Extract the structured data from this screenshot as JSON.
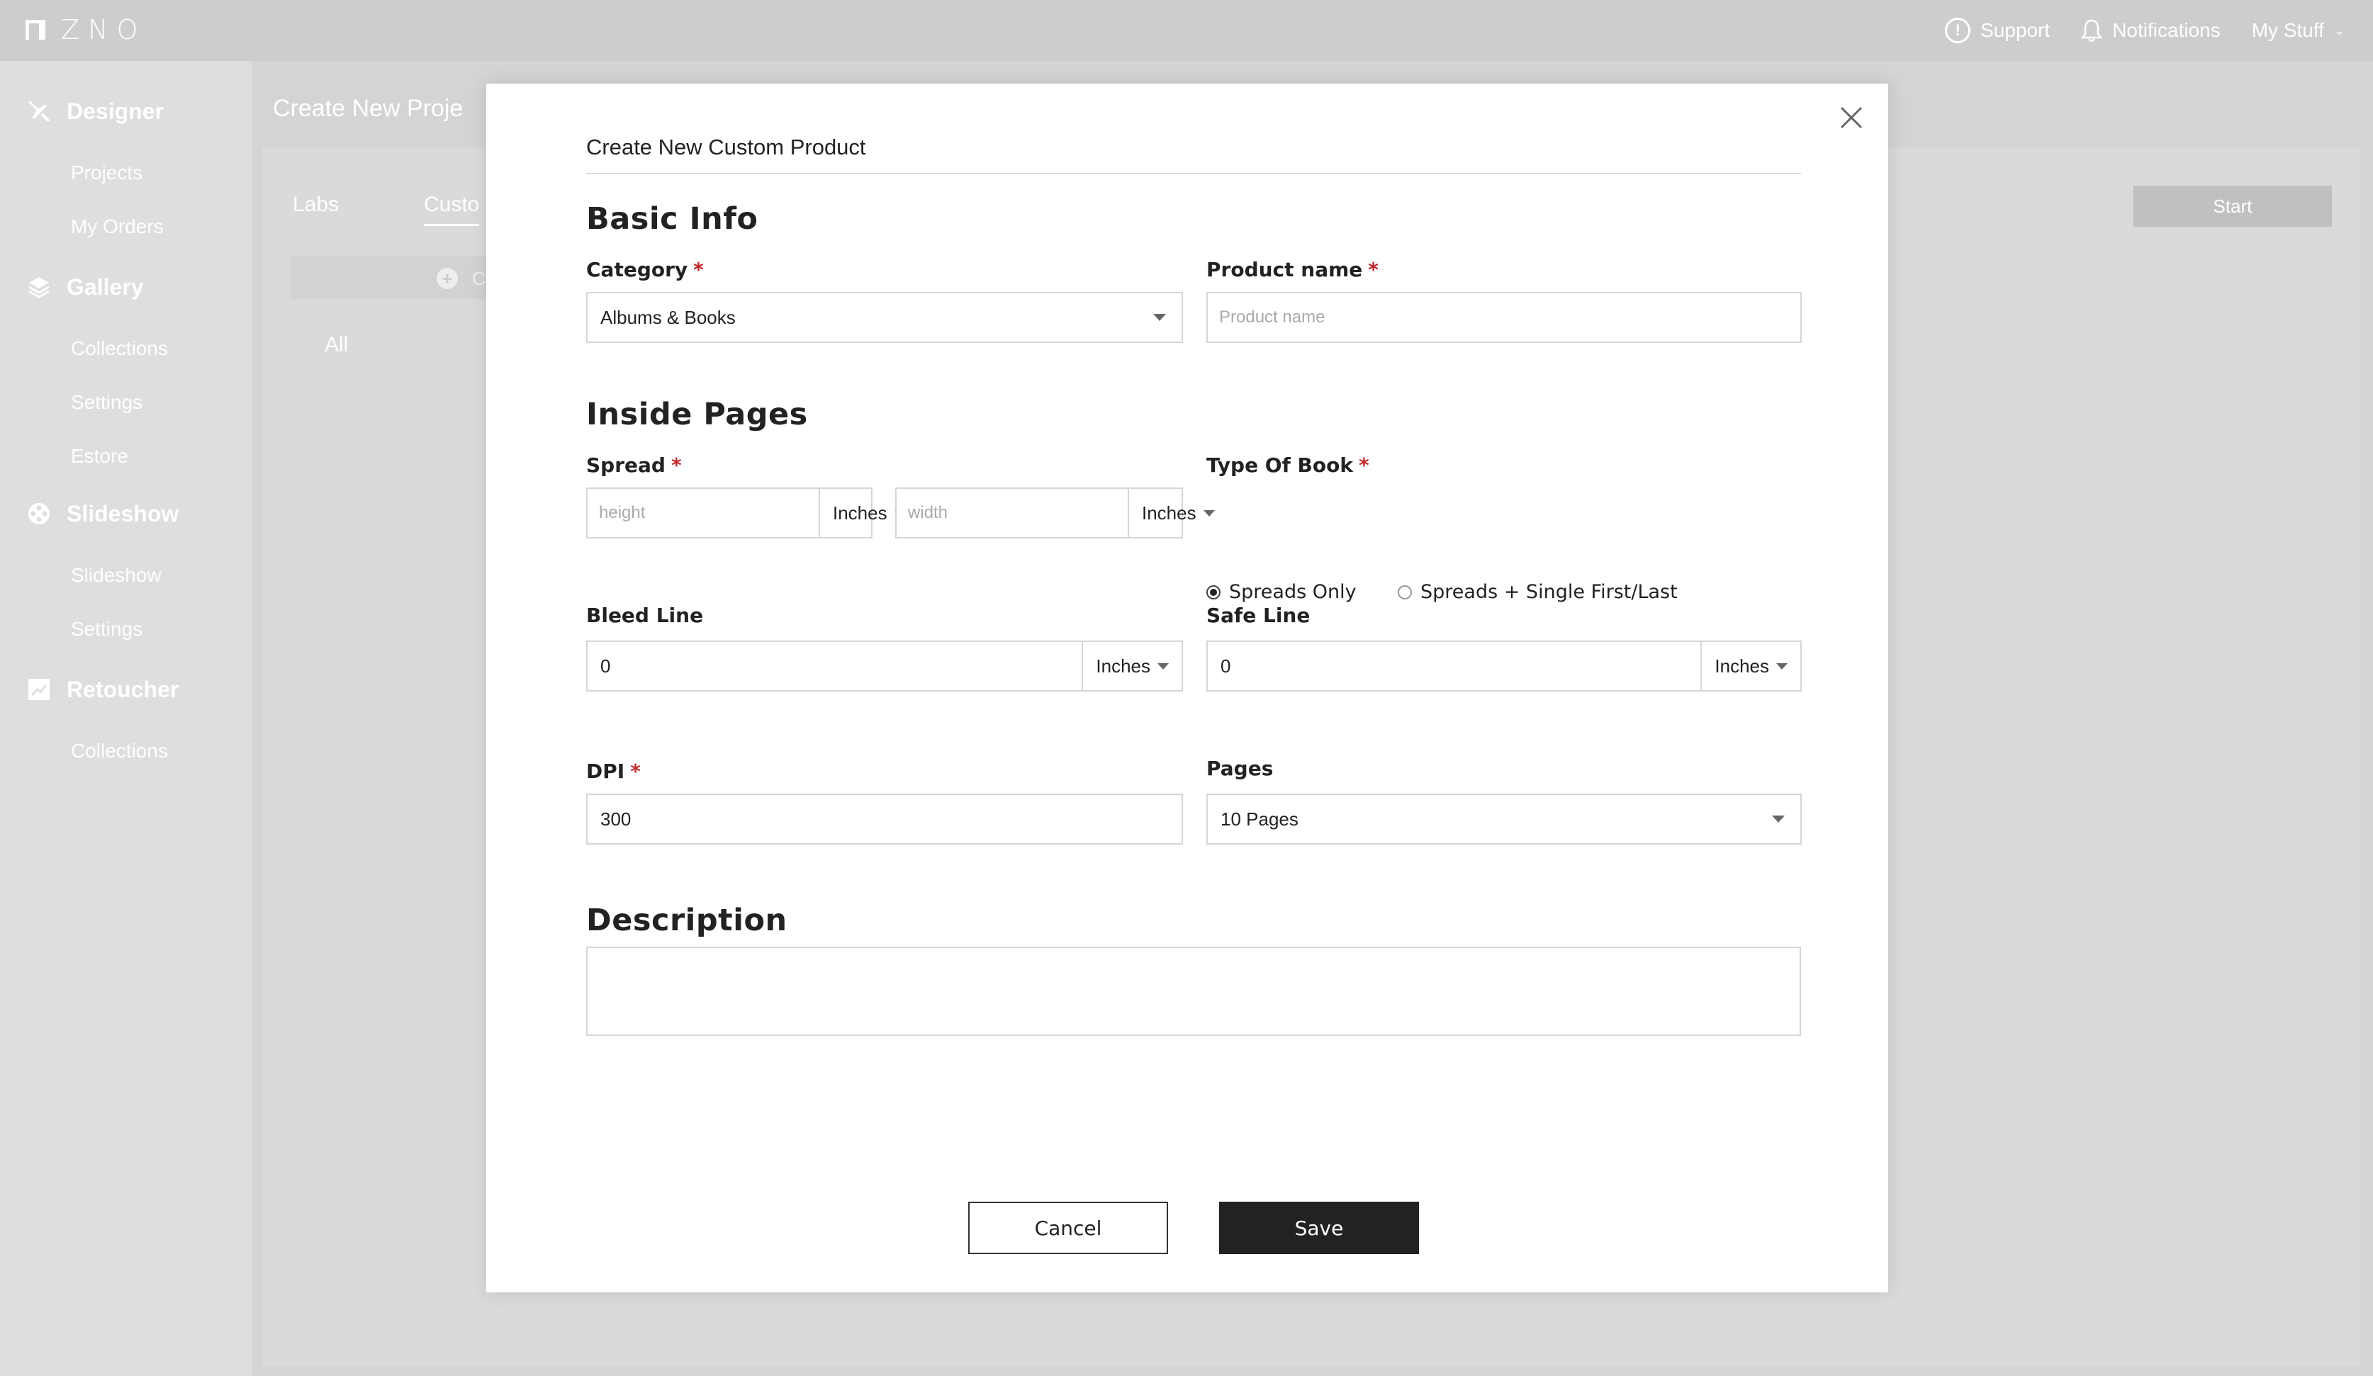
{
  "topbar": {
    "logo_text": "ZNO",
    "support_label": "Support",
    "notifications_label": "Notifications",
    "mystuff_label": "My Stuff",
    "support_icon_glyph": "!",
    "chevron_glyph": "⌄"
  },
  "sidebar": {
    "sections": [
      {
        "label": "Designer",
        "icon": "designer-icon",
        "items": [
          "Projects",
          "My Orders"
        ]
      },
      {
        "label": "Gallery",
        "icon": "gallery-icon",
        "items": [
          "Collections",
          "Settings",
          "Estore"
        ]
      },
      {
        "label": "Slideshow",
        "icon": "slideshow-icon",
        "items": [
          "Slideshow",
          "Settings"
        ]
      },
      {
        "label": "Retoucher",
        "icon": "retoucher-icon",
        "items": [
          "Collections"
        ]
      }
    ]
  },
  "background": {
    "title": "Create New Proje",
    "tabs": [
      "Labs",
      "Custo"
    ],
    "start_label": "Start",
    "add_label": "C",
    "add_glyph": "+",
    "all_label": "All"
  },
  "modal": {
    "title": "Create New Custom Product",
    "close_glyph": "×",
    "basic_info": {
      "heading": "Basic Info",
      "category_label": "Category",
      "category_value": "Albums & Books",
      "product_name_label": "Product name",
      "product_name_placeholder": "Product name"
    },
    "inside_pages": {
      "heading": "Inside Pages",
      "spread_label": "Spread",
      "height_placeholder": "height",
      "height_unit": "Inches",
      "width_placeholder": "width",
      "width_unit": "Inches",
      "type_of_book_label": "Type Of Book",
      "radio_options": [
        "Spreads Only",
        "Spreads + Single First/Last"
      ],
      "selected_radio": "Spreads Only",
      "bleed_line_label": "Bleed Line",
      "bleed_line_value": "0",
      "bleed_line_unit": "Inches",
      "safe_line_label": "Safe Line",
      "safe_line_value": "0",
      "safe_line_unit": "Inches",
      "dpi_label": "DPI",
      "dpi_value": "300",
      "pages_label": "Pages",
      "pages_value": "10 Pages"
    },
    "description": {
      "heading": "Description",
      "value": ""
    },
    "required_marker": "*",
    "cancel_label": "Cancel",
    "save_label": "Save"
  },
  "colors": {
    "required": "#c1272d",
    "save_bg": "#222222",
    "topbar_bg": "#cdcdcd"
  }
}
